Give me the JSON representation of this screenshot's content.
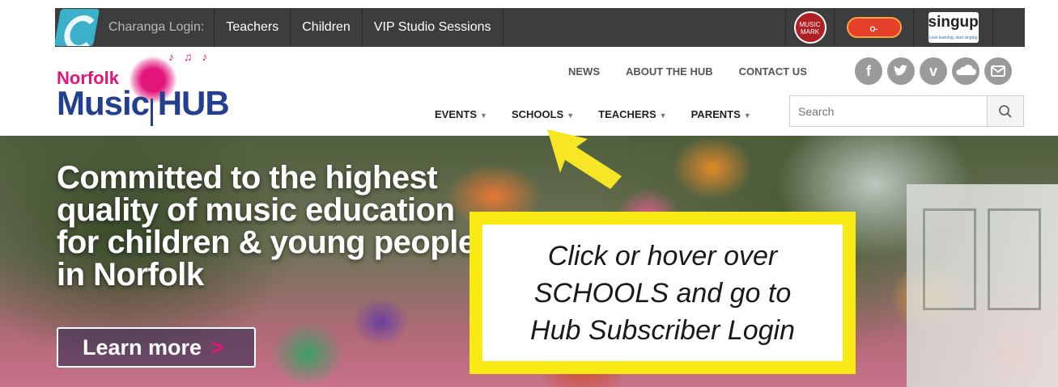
{
  "topbar": {
    "charanga_label": "Charanga Login:",
    "links": [
      "Teachers",
      "Children",
      "VIP Studio Sessions"
    ],
    "badges": {
      "music_mark": "MUSIC MARK",
      "o_generator": "O-GENERATOR",
      "sing_up": "singup",
      "sing_up_tagline": "Love learning, start singing"
    }
  },
  "logo": {
    "line1": "Norfolk",
    "line2": "Music HUB"
  },
  "util_nav": [
    "NEWS",
    "ABOUT THE HUB",
    "CONTACT US"
  ],
  "social_icons": [
    "facebook-icon",
    "twitter-icon",
    "vimeo-icon",
    "soundcloud-icon",
    "email-icon"
  ],
  "main_nav": [
    "EVENTS",
    "SCHOOLS",
    "TEACHERS",
    "PARENTS"
  ],
  "search": {
    "placeholder": "Search"
  },
  "hero": {
    "title": "Committed to the highest quality of music education for children & young people in Norfolk",
    "button_label": "Learn more",
    "button_arrow": ">"
  },
  "callout": {
    "line1": "Click or hover over",
    "line2": "SCHOOLS and go to",
    "line3": "Hub Subscriber Login"
  },
  "colors": {
    "topbar_bg": "#3d3d3d",
    "brand_pink": "#e2157b",
    "brand_blue": "#243f8f",
    "callout_border": "#f9ea15",
    "arrow_yellow": "#f7e626"
  }
}
